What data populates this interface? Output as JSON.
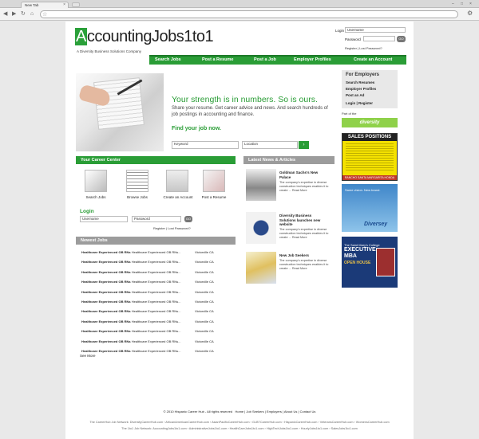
{
  "browser": {
    "tab_title": "New Tab",
    "tab_close": "×"
  },
  "site": {
    "logo_first": "A",
    "logo_rest": "ccountingJobs1to1",
    "tagline": "A Diversity Business Solutions Company"
  },
  "top_login": {
    "login_label": "Login",
    "username_placeholder": "Username",
    "password_label": "Password",
    "go_label": "GO",
    "register": "Register",
    "divider": "|",
    "lost_password": "Lost Password?"
  },
  "nav": [
    "Search Jobs",
    "Post a Resume",
    "Post a Job",
    "Employer Profiles",
    "Create an Account"
  ],
  "hero": {
    "headline": "Your strength is in numbers. So is ours.",
    "text": "Share your resume. Get career advice and news. And search hundreds of job postings in accounting and finance.",
    "find": "Find your job now.",
    "keyword_placeholder": "Keyword",
    "location_placeholder": "Location",
    "search_icon": "›"
  },
  "career_center": {
    "title": "Your Career Center",
    "items": [
      "Search Jobs",
      "Browse Jobs",
      "Create an Account",
      "Post a Resume"
    ]
  },
  "login_box": {
    "title": "Login",
    "username_placeholder": "Username",
    "password_placeholder": "Password",
    "go_label": "GO",
    "register": "Register",
    "lost_password": "Lost Password?"
  },
  "newest_jobs": {
    "title": "Newest Jobs",
    "see_more": "See More",
    "rows": [
      {
        "bold": "Healthcare Experienced OB RNs",
        "text": " Healthcare Experienced OB RNs...",
        "loc": "Victorville CA"
      },
      {
        "bold": "Healthcare Experienced OB RNs",
        "text": " Healthcare Experienced OB RNs...",
        "loc": "Victorville CA"
      },
      {
        "bold": "Healthcare Experienced OB RNs",
        "text": " Healthcare Experienced OB RNs...",
        "loc": "Victorville CA"
      },
      {
        "bold": "Healthcare Experienced OB RNs",
        "text": " Healthcare Experienced OB RNs...",
        "loc": "Victorville CA"
      },
      {
        "bold": "Healthcare Experienced OB RNs",
        "text": " Healthcare Experienced OB RNs...",
        "loc": "Victorville CA"
      },
      {
        "bold": "Healthcare Experienced OB RNs",
        "text": " Healthcare Experienced OB RNs...",
        "loc": "Victorville CA"
      },
      {
        "bold": "Healthcare Experienced OB RNs",
        "text": " Healthcare Experienced OB RNs...",
        "loc": "Victorville CA"
      },
      {
        "bold": "Healthcare Experienced OB RNs",
        "text": " Healthcare Experienced OB RNs...",
        "loc": "Victorville CA"
      },
      {
        "bold": "Healthcare Experienced OB RNs",
        "text": " Healthcare Experienced OB RNs...",
        "loc": "Victorville CA"
      },
      {
        "bold": "Healthcare Experienced OB RNs",
        "text": " Healthcare Experienced OB RNs...",
        "loc": "Victorville CA"
      },
      {
        "bold": "Healthcare Experienced OB RNs",
        "text": " Healthcare Experienced OB RNs...",
        "loc": "Victorville CA"
      }
    ]
  },
  "news": {
    "title": "Latest News & Articles",
    "items": [
      {
        "title": "Goldman Sachs's New Palace",
        "body": "The company's expertise in diverse construction techniques enables it to create ...",
        "more": "Read More"
      },
      {
        "title": "Diversity Business Solutions launches new website",
        "body": "The company's expertise in diverse construction techniques enables it to create ...",
        "more": "Read More"
      },
      {
        "title": "New Job Seekers",
        "body": "The company's expertise in diverse construction techniques enables it to create ...",
        "more": "Read More"
      }
    ]
  },
  "employers": {
    "title": "For Employers",
    "items": [
      "Search Resumes",
      "Employer Profiles",
      "Post an Ad"
    ],
    "login": "Login",
    "register": "Register",
    "part_of": "Part of the",
    "diversity_logo": "diversity"
  },
  "ads": {
    "ad1_title": "SALES POSITIONS",
    "ad1_bottom": "RANCHO SANTA MARGARITA HONDA",
    "ad2_text": "Same vision. New brand.",
    "ad2_logo": "Diversey",
    "ad3_small": "The Saint Mary's College",
    "ad3_big": "EXECUTIVE MBA",
    "ad3_open": "OPEN HOUSE"
  },
  "footer": {
    "copyright": "© 2010  Hispanic Career Hub - All rights reserved",
    "links": [
      "Home",
      "Job Seekers",
      "Employers",
      "About Us",
      "Contact Us"
    ],
    "network1": "The CareerHub Job Network:  DiversityCareerHub.com  ›  AfricanAmericanCareerHub.com  ›  AsianPacificCareerHub.com  ›  GLBTCareerHub.com  ›  HispanicCareerHub.com  ›  VeteransCareerHub.com  ›  WomensCareerHub.com",
    "network2": "The 1to1 Job Network:  AccountingJobs1to1.com  ›  AdministrativeJobs1to1.com  ›  HealthCareJobs1to1.com  ›  HighTechJobs1to1.com  ›  HourlyJobs1to1.com  ›  SalesJobs1to1.com"
  }
}
